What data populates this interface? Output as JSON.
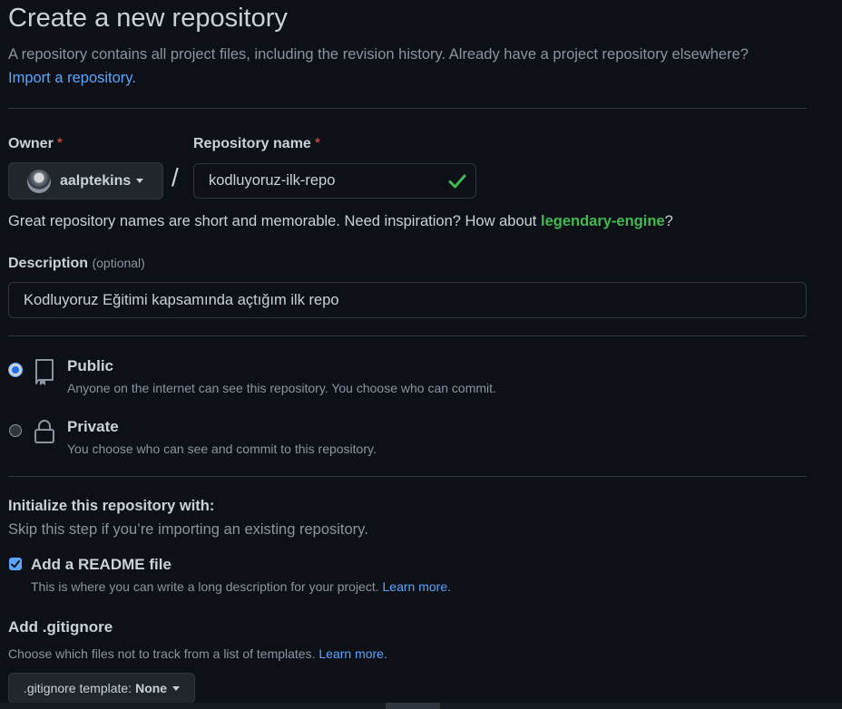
{
  "page": {
    "title": "Create a new repository",
    "subtitle": "A repository contains all project files, including the revision history. Already have a project repository elsewhere?",
    "import_link": "Import a repository."
  },
  "owner": {
    "label": "Owner",
    "required_mark": "*",
    "name": "aalptekins"
  },
  "repository": {
    "label": "Repository name",
    "required_mark": "*",
    "separator": "/",
    "value": "kodluyoruz-ilk-repo",
    "hint_prefix": "Great repository names are short and memorable. Need inspiration? How about",
    "suggestion": "legendary-engine",
    "hint_suffix": "?"
  },
  "description": {
    "label": "Description",
    "optional": "(optional)",
    "value": "Kodluyoruz Eğitimi kapsamında açtığım ilk repo"
  },
  "visibility": {
    "public": {
      "title": "Public",
      "description": "Anyone on the internet can see this repository. You choose who can commit.",
      "checked": true
    },
    "private": {
      "title": "Private",
      "description": "You choose who can see and commit to this repository.",
      "checked": false
    }
  },
  "initialize": {
    "title": "Initialize this repository with:",
    "subtitle": "Skip this step if you’re importing an existing repository.",
    "readme": {
      "title": "Add a README file",
      "description": "This is where you can write a long description for your project.",
      "learn_more": "Learn more.",
      "checked": true
    },
    "gitignore": {
      "title": "Add .gitignore",
      "description": "Choose which files not to track from a list of templates.",
      "learn_more": "Learn more.",
      "button_prefix": ".gitignore template:",
      "button_value": "None"
    }
  },
  "colors": {
    "background": "#0d1117",
    "link": "#58a6ff",
    "success": "#3fb950",
    "danger": "#f85149",
    "border": "#30363d"
  },
  "icons": {
    "owner_caret": "triangle-down-icon",
    "valid": "check-icon",
    "public": "repo-book-icon",
    "private": "lock-icon",
    "gitignore_caret": "triangle-down-icon"
  }
}
